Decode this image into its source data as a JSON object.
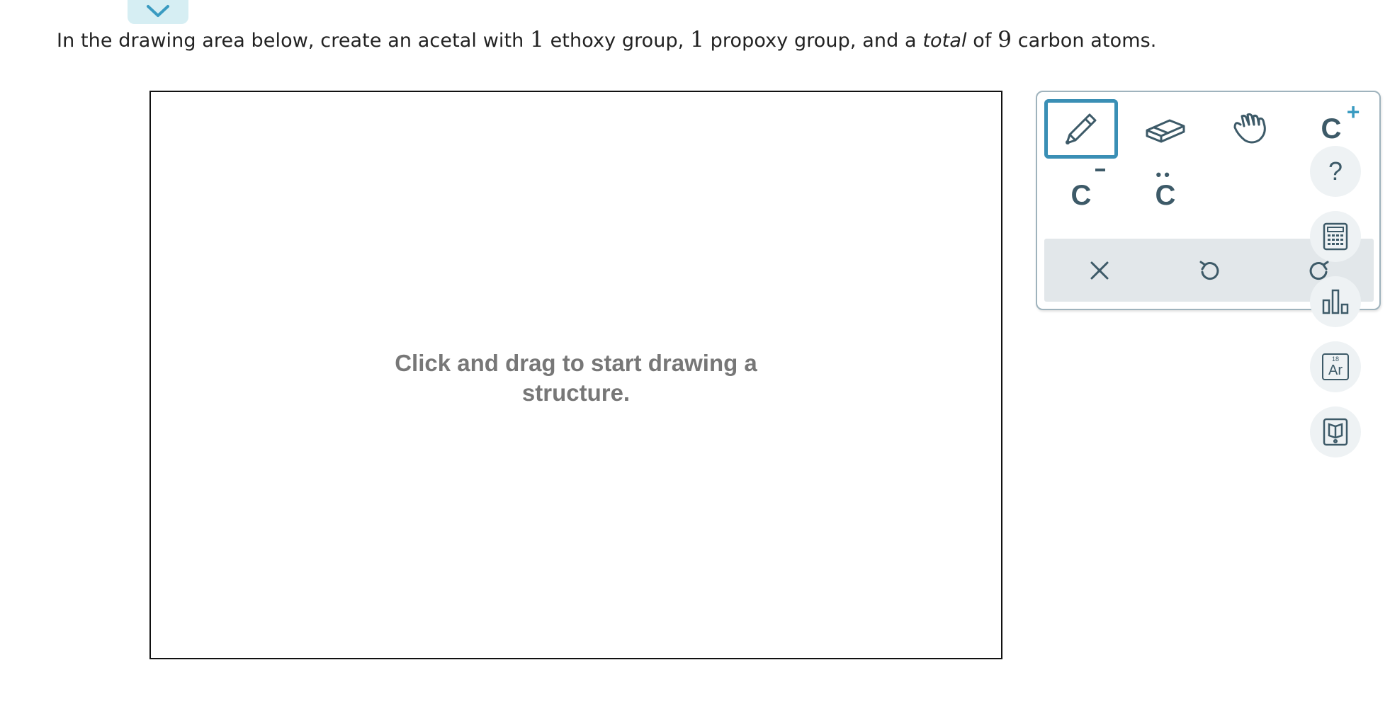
{
  "question": {
    "part1": "In the drawing area below, create an acetal with ",
    "num1": "1",
    "part2": " ethoxy group, ",
    "num2": "1",
    "part3": " propoxy group, and a ",
    "emphasis": "total",
    "part4": " of ",
    "num3": "9",
    "part5": " carbon atoms."
  },
  "canvas": {
    "hint_line1": "Click and drag to start drawing a",
    "hint_line2": "structure."
  },
  "toolbar": {
    "tools": [
      {
        "name": "pencil-tool",
        "icon": "pencil-icon",
        "active": true
      },
      {
        "name": "eraser-tool",
        "icon": "eraser-icon",
        "active": false
      },
      {
        "name": "hand-tool",
        "icon": "hand-icon",
        "active": false
      },
      {
        "name": "cation-tool",
        "label": "C",
        "mark": "+"
      },
      {
        "name": "anion-tool",
        "label": "C",
        "mark": "−"
      },
      {
        "name": "lone-pair-tool",
        "label": "C",
        "mark": "••"
      }
    ],
    "actions": [
      {
        "name": "clear-button",
        "icon": "close-icon"
      },
      {
        "name": "undo-button",
        "icon": "undo-icon"
      },
      {
        "name": "redo-button",
        "icon": "redo-icon"
      }
    ]
  },
  "side_tools": {
    "help": "?",
    "periodic_number": "18",
    "periodic_symbol": "Ar"
  },
  "colors": {
    "accent": "#3a8fb5",
    "icon": "#3d5a68",
    "action_bar": "#e2e7ea",
    "hint_text": "#777777"
  }
}
